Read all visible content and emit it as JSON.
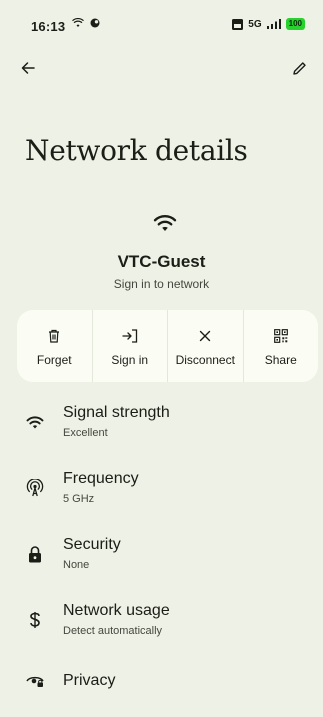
{
  "status_bar": {
    "time": "16:13",
    "network": "5G",
    "battery": "100"
  },
  "header": {
    "title": "Network details",
    "back_icon": "arrow-back-icon",
    "edit_icon": "pencil-edit-icon"
  },
  "network": {
    "name": "VTC-Guest",
    "status": "Sign in to network"
  },
  "actions": [
    {
      "label": "Forget",
      "icon": "trash-icon"
    },
    {
      "label": "Sign in",
      "icon": "sign-in-icon"
    },
    {
      "label": "Disconnect",
      "icon": "close-icon"
    },
    {
      "label": "Share",
      "icon": "qr-code-icon"
    }
  ],
  "details": [
    {
      "title": "Signal strength",
      "subtitle": "Excellent",
      "icon": "wifi-icon"
    },
    {
      "title": "Frequency",
      "subtitle": "5 GHz",
      "icon": "antenna-icon"
    },
    {
      "title": "Security",
      "subtitle": "None",
      "icon": "lock-icon"
    },
    {
      "title": "Network usage",
      "subtitle": "Detect automatically",
      "icon": "dollar-icon"
    },
    {
      "title": "Privacy",
      "subtitle": "",
      "icon": "privacy-eye-icon"
    }
  ],
  "colors": {
    "background": "#eef1e6",
    "card": "#fbfdf5",
    "text": "#1b1d17",
    "battery": "#27d22d"
  }
}
